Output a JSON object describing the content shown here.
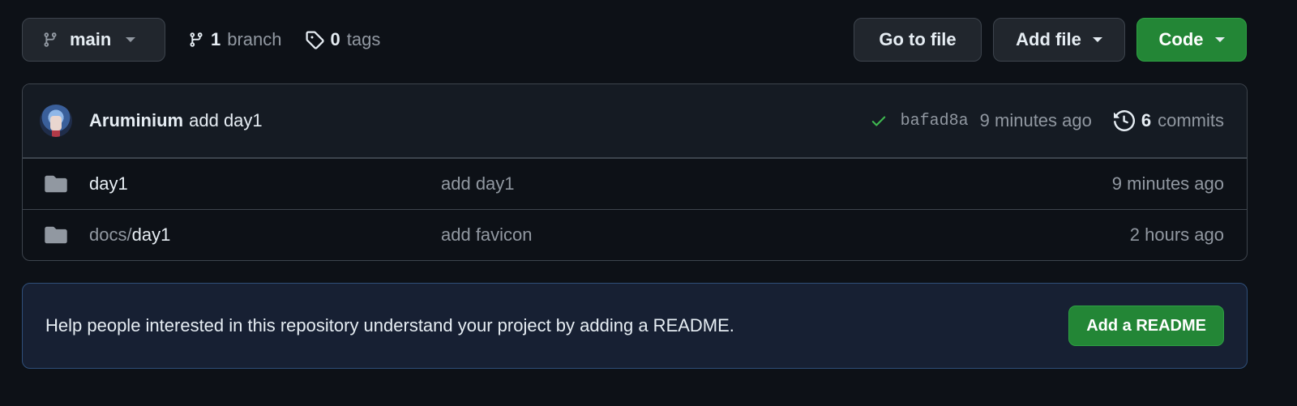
{
  "toolbar": {
    "branch_name": "main",
    "branch_count": "1",
    "branch_label": "branch",
    "tag_count": "0",
    "tag_label": "tags",
    "goto_file_label": "Go to file",
    "add_file_label": "Add file",
    "code_label": "Code"
  },
  "latest_commit": {
    "author": "Aruminium",
    "message": "add day1",
    "sha": "bafad8a",
    "time": "9 minutes ago",
    "commit_count": "6",
    "commit_label": "commits",
    "status_color": "#3fb950"
  },
  "files": [
    {
      "dir_prefix": "",
      "name": "day1",
      "message": "add day1",
      "time": "9 minutes ago",
      "icon": "folder-icon"
    },
    {
      "dir_prefix": "docs/",
      "name": "day1",
      "message": "add favicon",
      "time": "2 hours ago",
      "icon": "folder-icon"
    }
  ],
  "readme_banner": {
    "text": "Help people interested in this repository understand your project by adding a README.",
    "button_label": "Add a README"
  },
  "colors": {
    "background": "#0d1117",
    "accent_green": "#238636",
    "muted_text": "#9198a1"
  }
}
